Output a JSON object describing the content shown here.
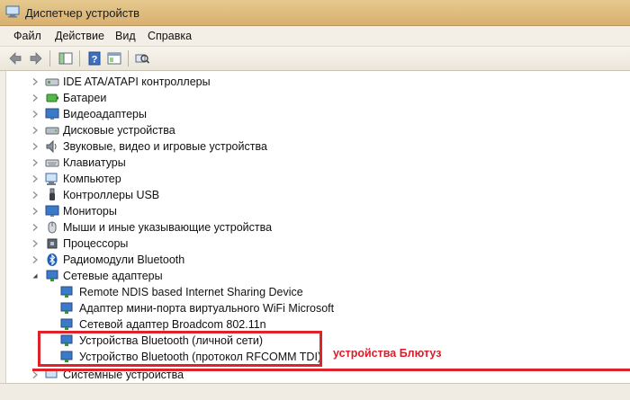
{
  "window": {
    "title": "Диспетчер устройств"
  },
  "menu": [
    "Файл",
    "Действие",
    "Вид",
    "Справка"
  ],
  "tree": {
    "categories": [
      {
        "label": "IDE ATA/ATAPI контроллеры",
        "icon": "ide-controller-icon"
      },
      {
        "label": "Батареи",
        "icon": "battery-icon"
      },
      {
        "label": "Видеоадаптеры",
        "icon": "display-adapter-icon"
      },
      {
        "label": "Дисковые устройства",
        "icon": "disk-drive-icon"
      },
      {
        "label": "Звуковые, видео и игровые устройства",
        "icon": "speaker-icon"
      },
      {
        "label": "Клавиатуры",
        "icon": "keyboard-icon"
      },
      {
        "label": "Компьютер",
        "icon": "computer-icon"
      },
      {
        "label": "Контроллеры USB",
        "icon": "usb-icon"
      },
      {
        "label": "Мониторы",
        "icon": "monitor-icon"
      },
      {
        "label": "Мыши и иные указывающие устройства",
        "icon": "mouse-icon"
      },
      {
        "label": "Процессоры",
        "icon": "processor-icon"
      },
      {
        "label": "Радиомодули Bluetooth",
        "icon": "bluetooth-icon"
      },
      {
        "label": "Сетевые адаптеры",
        "icon": "network-adapter-icon"
      }
    ],
    "network_children": [
      {
        "label": "Remote NDIS based Internet Sharing Device"
      },
      {
        "label": "Адаптер мини-порта виртуального WiFi Microsoft"
      },
      {
        "label": "Сетевой адаптер Broadcom 802.11n"
      },
      {
        "label": "Устройства Bluetooth (личной сети)"
      },
      {
        "label": "Устройство Bluetooth (протокол RFCOMM TDI)"
      }
    ],
    "cut_off_row": {
      "label": "Системные устройства"
    }
  },
  "annotation": {
    "text": "устройства Блютуз",
    "color": "#d81e2a"
  },
  "colors": {
    "highlight": "#e0222a",
    "titlebar": "#d8b06f"
  }
}
